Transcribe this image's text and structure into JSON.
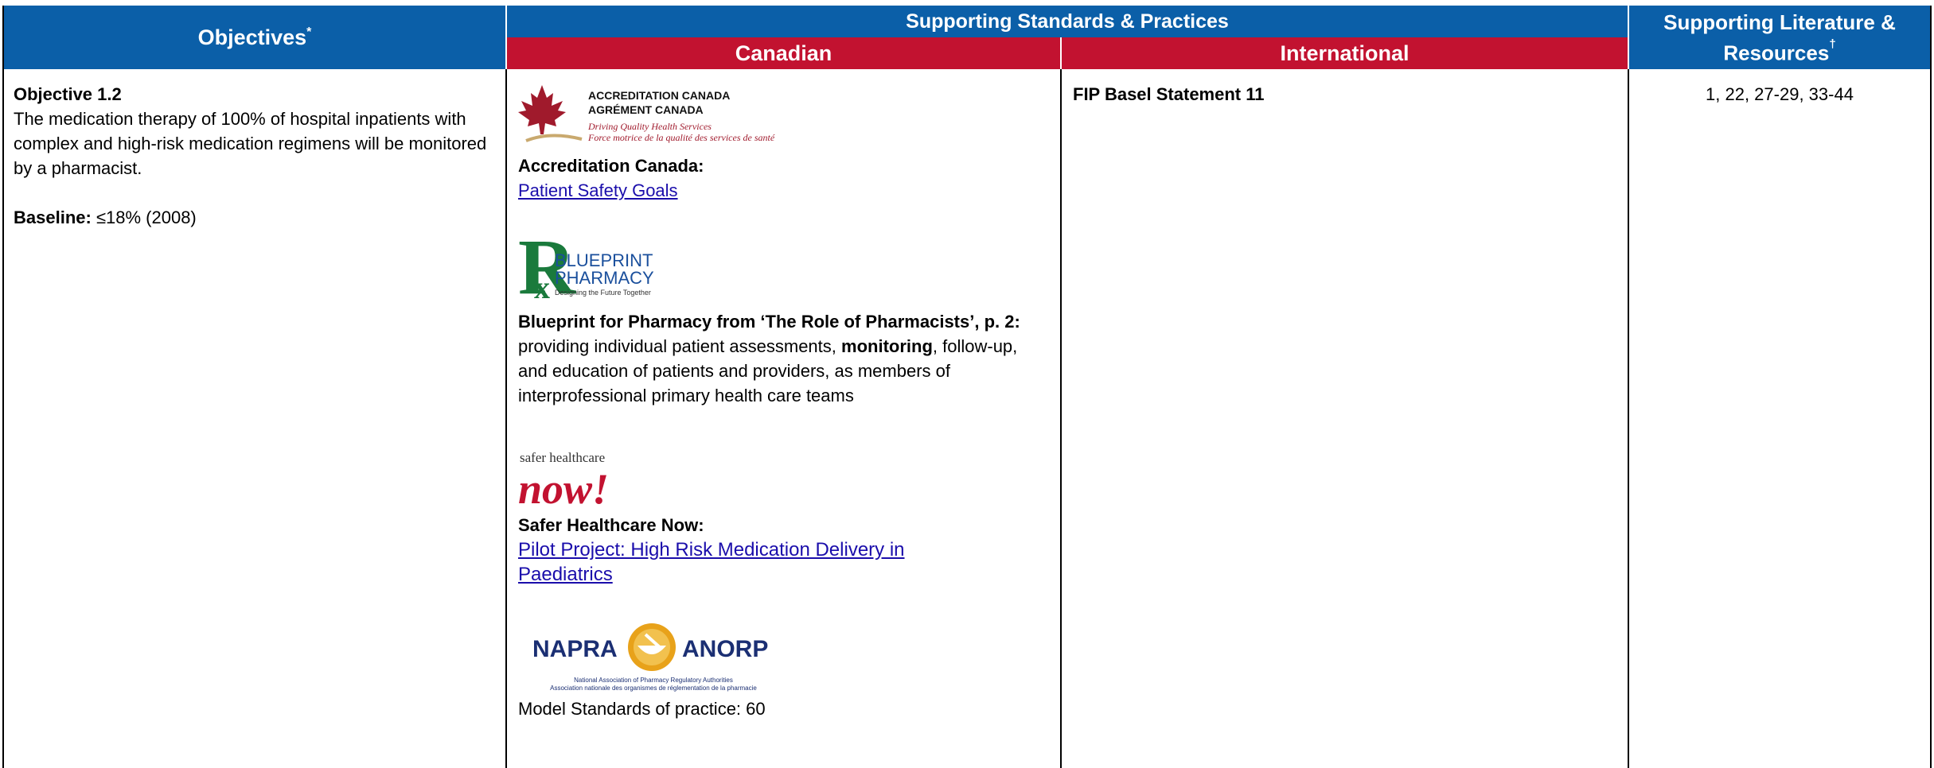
{
  "header": {
    "objectives": "Objectives",
    "objectives_mark": "*",
    "supporting": "Supporting Standards & Practices",
    "canadian": "Canadian",
    "international": "International",
    "literature_line1": "Supporting Literature  &",
    "literature_line2": "Resources",
    "literature_mark": "†"
  },
  "objective": {
    "title": "Objective 1.2",
    "text": "The medication therapy of 100% of hospital inpatients with complex and high-risk medication regimens will be monitored by a pharmacist.",
    "baseline_label": "Baseline:",
    "baseline_value": " ≤18% (2008)"
  },
  "canadian": {
    "acc_logo": {
      "line1": "ACCREDITATION CANADA",
      "line2": "AGRÉMENT CANADA",
      "line3": "Driving Quality Health Services",
      "line4": "Force motrice de la qualité des services de santé"
    },
    "acc_title": "Accreditation Canada:",
    "acc_link": "Patient Safety Goals",
    "rx_logo": {
      "line1": "BLUEPRINT",
      "line2": "PHARMACY",
      "line3": "Designing the Future Together"
    },
    "blueprint_title": "Blueprint for Pharmacy from ‘The Role of Pharmacists’, p. 2:",
    "blueprint_text1": "providing individual patient assessments, ",
    "blueprint_bold": "monitoring",
    "blueprint_text2": ", follow-up, and education of patients and providers, as members of interprofessional primary health care teams",
    "shn_logo": {
      "line1": "safer healthcare",
      "line2": "now!"
    },
    "shn_title": "Safer Healthcare Now:",
    "shn_link": "Pilot Project: High Risk Medication Delivery in Paediatrics",
    "napra_logo": {
      "left": "NAPRA",
      "right": "ANORP",
      "line1": "National Association of Pharmacy Regulatory Authorities",
      "line2": "Association nationale des organismes de réglementation de la pharmacie"
    },
    "napra_text": "Model Standards of practice: 60"
  },
  "international": {
    "title": "FIP Basel Statement 11"
  },
  "literature": {
    "refs": "1, 22, 27-29, 33-44"
  }
}
